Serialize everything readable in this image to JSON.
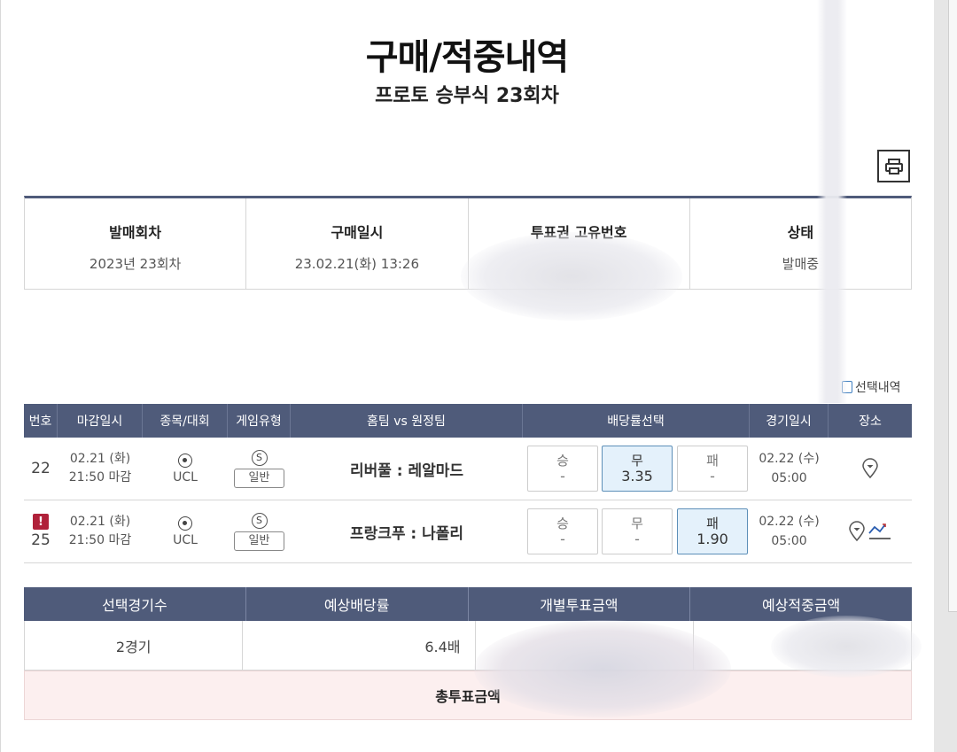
{
  "header": {
    "title": "구매/적중내역",
    "subtitle": "프로토 승부식 23회차"
  },
  "info": [
    {
      "label": "발매회차",
      "value": "2023년 23회차"
    },
    {
      "label": "구매일시",
      "value": "23.02.21(화) 13:26"
    },
    {
      "label": "투표권 고유번호",
      "value": ""
    },
    {
      "label": "상태",
      "value": "발매중"
    }
  ],
  "select_toggle_label": "선택내역",
  "match_columns": [
    "번호",
    "마감일시",
    "종목/대회",
    "게임유형",
    "홈팀 vs 원정팀",
    "배당률선택",
    "경기일시",
    "장소"
  ],
  "matches": [
    {
      "number": "22",
      "alert": false,
      "deadline_date": "02.21 (화)",
      "deadline_time": "21:50 마감",
      "sport_icon": "soccer-ball-icon",
      "league": "UCL",
      "type_badge": "S",
      "game_type": "일반",
      "teams": "리버풀 : 레알마드",
      "odds": [
        {
          "label": "승",
          "value": "-",
          "selected": false
        },
        {
          "label": "무",
          "value": "3.35",
          "selected": true
        },
        {
          "label": "패",
          "value": "-",
          "selected": false
        }
      ],
      "match_date": "02.22 (수)",
      "match_time": "05:00",
      "has_chart": false
    },
    {
      "number": "25",
      "alert": true,
      "alert_text": "!",
      "deadline_date": "02.21 (화)",
      "deadline_time": "21:50 마감",
      "sport_icon": "soccer-ball-icon",
      "league": "UCL",
      "type_badge": "S",
      "game_type": "일반",
      "teams": "프랑크푸 : 나폴리",
      "odds": [
        {
          "label": "승",
          "value": "-",
          "selected": false
        },
        {
          "label": "무",
          "value": "-",
          "selected": false
        },
        {
          "label": "패",
          "value": "1.90",
          "selected": true
        }
      ],
      "match_date": "02.22 (수)",
      "match_time": "05:00",
      "has_chart": true
    }
  ],
  "summary": {
    "columns": [
      "선택경기수",
      "예상배당률",
      "개별투표금액",
      "예상적중금액"
    ],
    "values": [
      "2경기",
      "6.4배",
      "",
      ""
    ],
    "total_label": "총투표금액"
  },
  "colors": {
    "header_bg": "#4f5b7a",
    "selected_odd_bg": "#e4f1fb",
    "total_bg": "#fcefef",
    "alert": "#b0213a"
  }
}
